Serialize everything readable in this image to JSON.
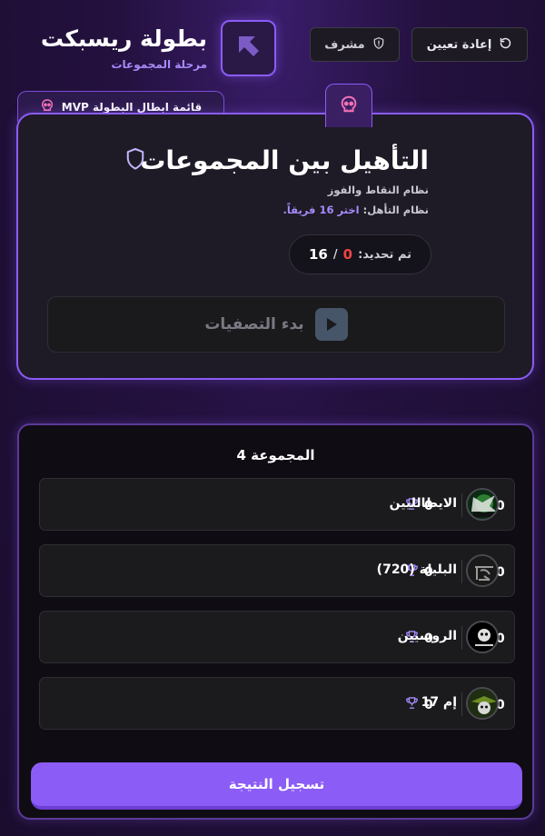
{
  "header": {
    "title": "بطولة ريسبكت",
    "subtitle": "مرحلة المجموعات",
    "reset_label": "إعادة تعيين",
    "admin_label": "مشرف"
  },
  "mvp_tab": {
    "label": "قائمة ابطال البطولة MVP"
  },
  "qualification": {
    "title": "التأهيل بين المجموعات",
    "system_text": "نظام النقاط والفوز",
    "qualify_label": "نظام التأهل:",
    "qualify_value": "اختر 16 فريقاً.",
    "selected_label": "تم تحديد:",
    "selected_count": "0",
    "separator": "/",
    "selected_total": "16",
    "start_label": "بدء التصفيات"
  },
  "group": {
    "title": "المجموعة 4",
    "teams": [
      {
        "name": "الايطالليين",
        "trophies": "0",
        "coins": "0"
      },
      {
        "name": "البليلة (720)",
        "trophies": "0",
        "coins": "0"
      },
      {
        "name": "الروسيين",
        "trophies": "0",
        "coins": "0"
      },
      {
        "name": "إم 17",
        "trophies": "0",
        "coins": "0"
      }
    ],
    "submit_label": "تسجيل النتيجة"
  },
  "colors": {
    "accent": "#8b5cf6",
    "danger": "#ef4444",
    "coin": "#d4a017"
  },
  "icons": {
    "reset": "refresh-icon",
    "admin": "shield-alert-icon",
    "logo": "arrow-logo-icon",
    "skull": "skull-icon",
    "shield": "shield-icon",
    "play": "play-icon",
    "trophy": "trophy-icon",
    "coins": "coins-icon"
  }
}
